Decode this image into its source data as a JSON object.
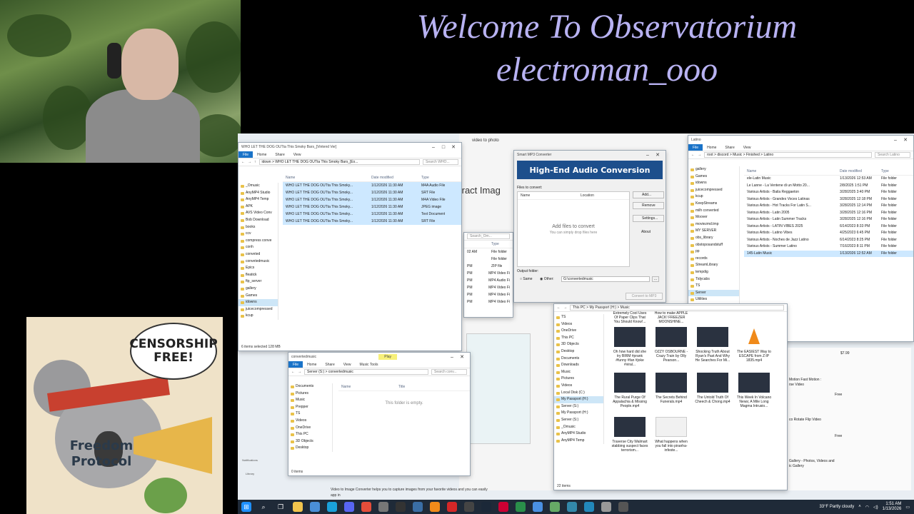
{
  "overlay": {
    "title_line1": "Welcome To Observatorium",
    "title_line2": "electroman_ooo",
    "koala_bubble": "CENSORSHIP FREE!",
    "koala_sign_line1": "Freedom",
    "koala_sign_line2": "Protocol"
  },
  "explorer1": {
    "title": "WHO LET THE DOG OUTta This Smoky Bars_[Vintend Ver]",
    "tabs": [
      "File",
      "Home",
      "Share",
      "View"
    ],
    "address": "idown > WHO LET THE DOG OUTta This Smoky Bars_[Ex...",
    "search": "Search WHO...",
    "columns": [
      "Name",
      "Date modified",
      "Type"
    ],
    "nav": [
      "_Omusic",
      "AnyMP4 Studio",
      "AnyMP4 Temp",
      "APK",
      "AVS Video Conv",
      "Bob Download",
      "books",
      "ccv",
      "compress conve",
      "conh",
      "conveted",
      "convetedmusic",
      "Epics",
      "fleatick",
      "ftp_server",
      "gallery",
      "Games",
      "idowns",
      "juicecompressed",
      "kcup"
    ],
    "files": [
      {
        "name": "WHO LET THE DOG OUTta This Smoky...",
        "date": "1/12/2026 11:30 AM",
        "type": "M4A Audio File"
      },
      {
        "name": "WHO LET THE DOG OUTta This Smoky...",
        "date": "1/12/2026 11:30 AM",
        "type": "SRT File"
      },
      {
        "name": "WHO LET THE DOG OUTta This Smoky...",
        "date": "1/12/2026 11:30 AM",
        "type": "M4A Video File"
      },
      {
        "name": "WHO LET THE DOG OUTta This Smoky...",
        "date": "1/12/2026 11:30 AM",
        "type": "JPEG image"
      },
      {
        "name": "WHO LET THE DOG OUTta This Smoky...",
        "date": "1/12/2026 11:30 AM",
        "type": "Text Document"
      },
      {
        "name": "WHO LET THE DOG OUTta This Smoky...",
        "date": "1/12/2026 11:30 AM",
        "type": "SRT File"
      }
    ],
    "status": "6 items selected 128 MB"
  },
  "converter": {
    "title": "Smart MP3 Converter",
    "banner": "High-End Audio Conversion",
    "files_label": "Files to convert:",
    "col_name": "Name",
    "col_location": "Location",
    "empty_title": "Add files to convert",
    "empty_sub": "You can simply drop files here",
    "buttons": [
      "Add...",
      "Remove",
      "Settings...",
      "About"
    ],
    "output_label": "Output folder:",
    "opt_same": "Same",
    "opt_other": "Other:",
    "output_path": "G:\\convertedmusic",
    "convert_btn": "Convert to MP3"
  },
  "bg_app": {
    "tab": "video to photo",
    "heading": "tract Imag",
    "footer": "Video to Image Converter helps you to capture images from your favorite videos and you can easily",
    "footer2": "app in"
  },
  "explorer_latino": {
    "title": "Latino",
    "tabs": [
      "File",
      "Home",
      "Share",
      "View"
    ],
    "address": "root > discord > Music > Finished > Latino",
    "search": "Search Latino",
    "columns": [
      "Name",
      "Date modified",
      "Type"
    ],
    "nav": [
      "gallery",
      "Games",
      "idowns",
      "juicecompressed",
      "kcup",
      "KeepStreams",
      "milh converted",
      "Moover",
      "moviezmd.tmp",
      "MY SERVER",
      "obs_library",
      "obstoposandstuff",
      "pp",
      "records",
      "StreamLibrary",
      "tempdig",
      "Tidycabs",
      "TS",
      "Server",
      "Utilities"
    ],
    "files": [
      {
        "name": "ele-Latin Music",
        "date": "1/13/2026 12:53 AM",
        "type": "File folder"
      },
      {
        "name": "Le Lanne - La Ventene di un Motto 20...",
        "date": "2/8/2025 1:51 PM",
        "type": "File folder"
      },
      {
        "name": "Various Artists - Baila Reggaeton",
        "date": "3/28/2025 3:40 PM",
        "type": "File folder"
      },
      {
        "name": "Various Artists - Grandes Voces Latinas",
        "date": "3/28/2025 12:18 PM",
        "type": "File folder"
      },
      {
        "name": "Various Artists - Hot Tracks For Latin S...",
        "date": "3/28/2025 12:14 PM",
        "type": "File folder"
      },
      {
        "name": "Various Artists - Latin 2005",
        "date": "3/28/2025 12:16 PM",
        "type": "File folder"
      },
      {
        "name": "Various Artists - Latin Summer Tracks",
        "date": "3/28/2025 12:16 PM",
        "type": "File folder"
      },
      {
        "name": "Various Artists - LATIN VIBES 2025",
        "date": "6/14/2023 8:33 PM",
        "type": "File folder"
      },
      {
        "name": "Various Artists - Latino Vibes",
        "date": "4/25/2023 6:45 PM",
        "type": "File folder"
      },
      {
        "name": "Various Artists - Noches de Jazz Latino",
        "date": "6/14/2023 8:25 PM",
        "type": "File folder"
      },
      {
        "name": "Various Artists - Summer Latino",
        "date": "7/16/2023 8:11 PM",
        "type": "File folder"
      },
      {
        "name": "145-Latin Music",
        "date": "1/13/2026 12:52 AM",
        "type": "File folder"
      }
    ],
    "status": "12 items  1 item selected"
  },
  "explorer_music": {
    "tabs": [
      "File",
      "Home",
      "Share",
      "View"
    ],
    "address": "This PC > My Passport (H:) > Music",
    "nav": [
      "TS",
      "Videos",
      "OneDrive",
      "This PC",
      "3D Objects",
      "Desktop",
      "Documents",
      "Downloads",
      "Music",
      "Pictures",
      "Videos",
      "Local Disk (C:)",
      "My Passport (H:)",
      "Server (S:)",
      "My Passport (H:)",
      "Server (S:)",
      "_Omusic",
      "AnyMP4 Studio",
      "AnyMP4 Temp"
    ],
    "items": [
      "Extremely Cool Uses Of Paper Clips That You Should Know!...",
      "How to make APPLE JACK! FREEZER MOONSHINE...",
      "Oh how hard did she try BIRM #prank #funny #fan #joke #viral...",
      "OZZY OSBOURNE - Crazy Train by Olly Pearson...",
      "Shocking Truth About Ryan's Past And Why He Searches For Mi...",
      "The EASIEST Way to ESCAPE from Z:IP 1835.mp4",
      "The Rural Purge Of Appalachia & Missing People.mp4",
      "The Secrets Behind Funerals.mp4",
      "The Untold Truth Of Cheech & Chong.mp4",
      "This Week In Volcano News; A Mile Long Magma Intrusio...",
      "Traverse City Walmart stabbing suspect faces terrorism...",
      "What happens when you fall into piranha-infeste..."
    ],
    "status": "22 items"
  },
  "explorer_empty": {
    "title": "convertedmusic",
    "play_tab": "Play",
    "tabs": [
      "File",
      "Home",
      "Share",
      "View",
      "Music Tools"
    ],
    "address": "Server (S:) > convertedmusic",
    "search": "Search conv...",
    "col_name": "Name",
    "col_title": "Title",
    "empty": "This folder is empty.",
    "nav": [
      "Documents",
      "Pictures",
      "Music",
      "Prepper",
      "TS",
      "Videos",
      "OneDrive",
      "This PC",
      "3D Objects",
      "Desktop"
    ],
    "status": "0 items"
  },
  "right_panel": {
    "price": "$7.99",
    "text1": "Motion Fast Motion :",
    "text2": "rse Video",
    "text3": "Free",
    "text4": "co Rotate Flip Video",
    "text5": "Free",
    "text6": "Gallery - Photos, Videos and",
    "text7": "ic Gallery"
  },
  "sidebar_mini": {
    "item1": "Notifications",
    "item2": "Library"
  },
  "partial_list": {
    "search": "Search_Om...",
    "type_col": "Type",
    "rows": [
      {
        "date": "02 AM",
        "type": "File folder"
      },
      {
        "date": "",
        "type": "File folder"
      },
      {
        "date": "PM",
        "type": "ZIP file"
      },
      {
        "date": "PM",
        "type": "MP4 Video File"
      },
      {
        "date": "PM",
        "type": "MP4 Audio File"
      },
      {
        "date": "PM",
        "type": "MP4 Video File"
      },
      {
        "date": "PM",
        "type": "MP4 Video File"
      },
      {
        "date": "PM",
        "type": "MP4 Video File"
      }
    ]
  },
  "taskbar": {
    "weather": "33°F Partly cloudy",
    "time": "1:51 AM",
    "date": "1/13/2026"
  }
}
